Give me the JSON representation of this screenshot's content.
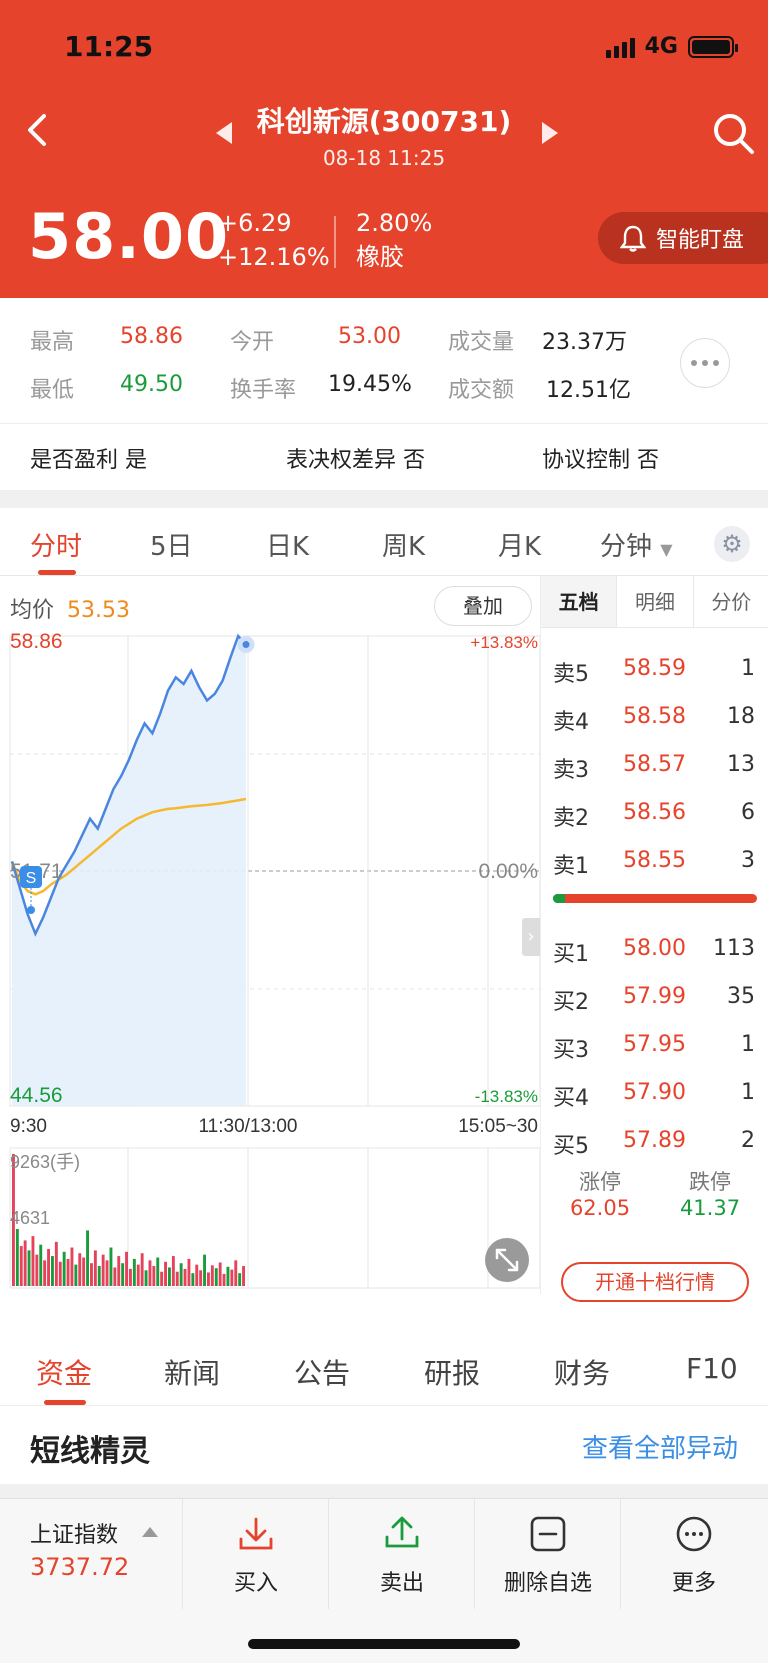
{
  "status": {
    "time": "11:25",
    "network": "4G"
  },
  "header": {
    "title": "科创新源(300731)",
    "subtitle": "08-18 11:25",
    "price": "58.00",
    "change": "+6.29",
    "change_pct": "+12.16%",
    "turnover_or_sector_pct": "2.80%",
    "sector": "橡胶",
    "watch_label": "智能盯盘"
  },
  "stats": {
    "high_label": "最高",
    "high": "58.86",
    "open_label": "今开",
    "open": "53.00",
    "volume_label": "成交量",
    "volume": "23.37万",
    "low_label": "最低",
    "low": "49.50",
    "turnover_label": "换手率",
    "turnover": "19.45%",
    "amount_label": "成交额",
    "amount": "12.51亿"
  },
  "flags": {
    "profit": "是否盈利 是",
    "voting": "表决权差异 否",
    "control": "协议控制 否"
  },
  "chart_tabs": [
    "分时",
    "5日",
    "日K",
    "周K",
    "月K",
    "分钟"
  ],
  "chart_info": {
    "avg_label": "均价",
    "avg_value": "53.53",
    "overlay_label": "叠加",
    "y_top": "58.86",
    "y_mid": "51.71",
    "y_bottom": "44.56",
    "pct_top": "+13.83%",
    "pct_mid": "0.00%",
    "pct_bottom": "-13.83%",
    "t_start": "9:30",
    "t_mid": "11:30/13:00",
    "t_end": "15:05~30",
    "vol_max": "9263(手)",
    "vol_mid": "4631",
    "marker": "S"
  },
  "chart_data": {
    "type": "line",
    "ylim": [
      44.56,
      58.86
    ],
    "series": [
      {
        "values": [
          52.0,
          51.2,
          50.4,
          49.8,
          50.3,
          50.9,
          51.5,
          51.9,
          52.3,
          52.8,
          53.3,
          53.0,
          53.6,
          54.2,
          54.6,
          55.1,
          55.7,
          56.2,
          55.9,
          56.5,
          57.2,
          57.6,
          57.4,
          57.8,
          57.3,
          56.9,
          57.1,
          57.5,
          58.2,
          58.86,
          58.6
        ]
      },
      {
        "values": [
          52.0,
          51.4,
          51.1,
          51.0,
          51.1,
          51.3,
          51.45,
          51.6,
          51.8,
          52.0,
          52.2,
          52.4,
          52.6,
          52.8,
          53.0,
          53.15,
          53.3,
          53.4,
          53.5,
          53.55,
          53.6,
          53.62,
          53.65,
          53.68,
          53.7,
          53.72,
          53.75,
          53.78,
          53.82,
          53.86,
          53.9
        ]
      }
    ],
    "volume": [
      9263,
      4000,
      2800,
      3200,
      2500,
      3500,
      2200,
      2900,
      1800,
      2600,
      2100,
      3100,
      1700,
      2400,
      1900,
      2700,
      1500,
      2300,
      2000,
      3900,
      1600,
      2500,
      1400,
      2200,
      1800,
      2700,
      1300,
      2100,
      1600,
      2400,
      1200,
      1900,
      1500,
      2300,
      1100,
      1800,
      1400,
      2000,
      1000,
      1700,
      1300,
      2100,
      1000,
      1600,
      1200,
      1900,
      900,
      1500,
      1100,
      2200,
      950,
      1450,
      1250,
      1650,
      850,
      1350,
      1150,
      1800,
      900,
      1400
    ]
  },
  "orderbook": {
    "tabs": [
      "五档",
      "明细",
      "分价"
    ],
    "asks": [
      {
        "name": "卖5",
        "price": "58.59",
        "vol": "1"
      },
      {
        "name": "卖4",
        "price": "58.58",
        "vol": "18"
      },
      {
        "name": "卖3",
        "price": "58.57",
        "vol": "13"
      },
      {
        "name": "卖2",
        "price": "58.56",
        "vol": "6"
      },
      {
        "name": "卖1",
        "price": "58.55",
        "vol": "3"
      }
    ],
    "bids": [
      {
        "name": "买1",
        "price": "58.00",
        "vol": "113"
      },
      {
        "name": "买2",
        "price": "57.99",
        "vol": "35"
      },
      {
        "name": "买3",
        "price": "57.95",
        "vol": "1"
      },
      {
        "name": "买4",
        "price": "57.90",
        "vol": "1"
      },
      {
        "name": "买5",
        "price": "57.89",
        "vol": "2"
      }
    ],
    "limit_up_label": "涨停",
    "limit_up": "62.05",
    "limit_down_label": "跌停",
    "limit_down": "41.37",
    "ten_level_label": "开通十档行情"
  },
  "news_tabs": [
    "资金",
    "新闻",
    "公告",
    "研报",
    "财务",
    "F10"
  ],
  "section": {
    "title": "短线精灵",
    "link": "查看全部异动"
  },
  "bottom": {
    "index_name": "上证指数",
    "index_value": "3737.72",
    "buy": "买入",
    "sell": "卖出",
    "remove": "删除自选",
    "more": "更多"
  },
  "colors": {
    "brand": "#e5432b",
    "up": "#e5432b",
    "down": "#1a9c3c",
    "price_line": "#4a86e0",
    "avg_line": "#f5b82e"
  }
}
